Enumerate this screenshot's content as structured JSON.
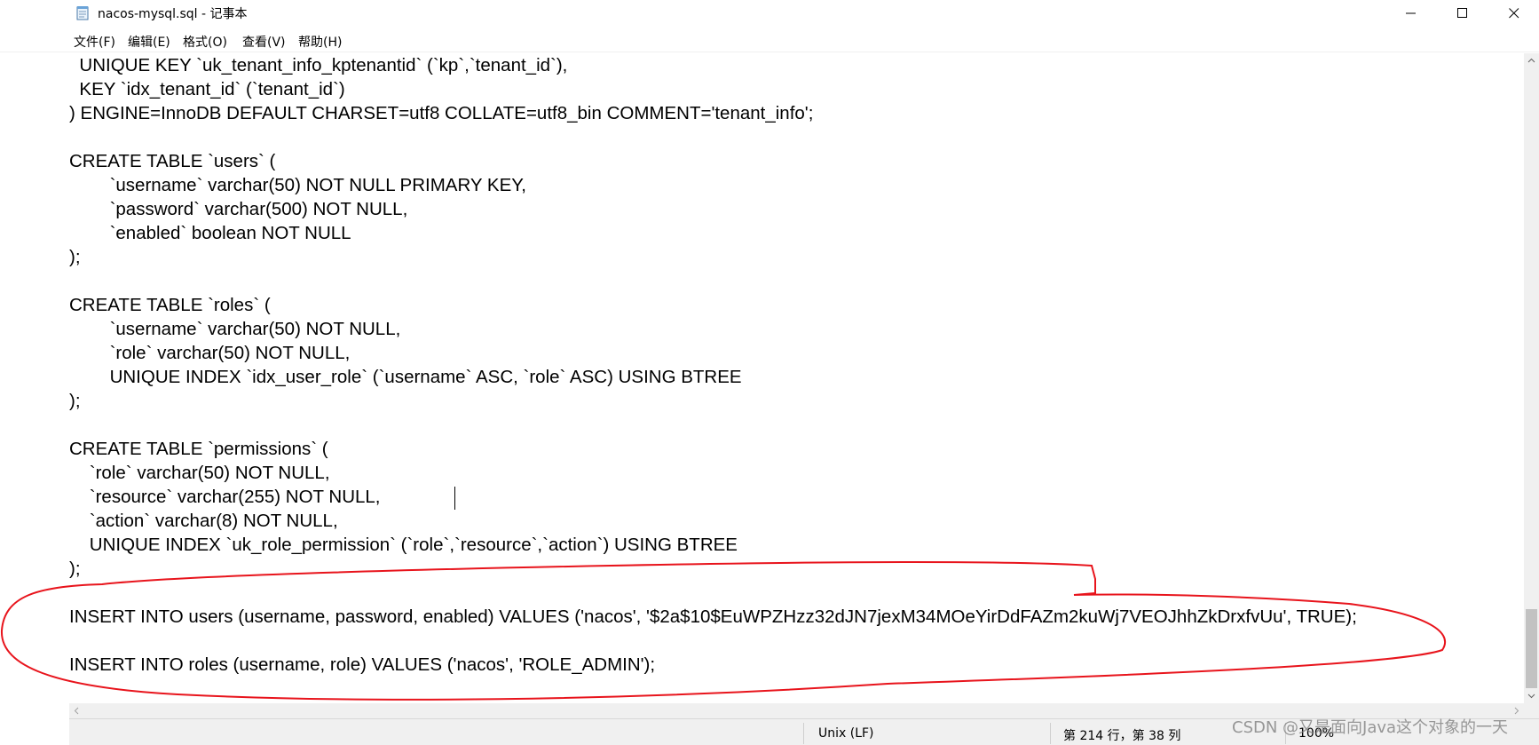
{
  "window": {
    "title": "nacos-mysql.sql - 记事本",
    "controls": {
      "minimize_icon": "minimize-icon",
      "maximize_icon": "maximize-icon",
      "close_icon": "close-icon"
    }
  },
  "menu": {
    "file": "文件(F)",
    "edit": "编辑(E)",
    "format": "格式(O)",
    "view": "查看(V)",
    "help": "帮助(H)"
  },
  "editor": {
    "lines": [
      "  UNIQUE KEY `uk_tenant_info_kptenantid` (`kp`,`tenant_id`),",
      "  KEY `idx_tenant_id` (`tenant_id`)",
      ") ENGINE=InnoDB DEFAULT CHARSET=utf8 COLLATE=utf8_bin COMMENT='tenant_info';",
      "",
      "CREATE TABLE `users` (",
      "\t`username` varchar(50) NOT NULL PRIMARY KEY,",
      "\t`password` varchar(500) NOT NULL,",
      "\t`enabled` boolean NOT NULL",
      ");",
      "",
      "CREATE TABLE `roles` (",
      "\t`username` varchar(50) NOT NULL,",
      "\t`role` varchar(50) NOT NULL,",
      "\tUNIQUE INDEX `idx_user_role` (`username` ASC, `role` ASC) USING BTREE",
      ");",
      "",
      "CREATE TABLE `permissions` (",
      "    `role` varchar(50) NOT NULL,",
      "    `resource` varchar(255) NOT NULL,",
      "    `action` varchar(8) NOT NULL,",
      "    UNIQUE INDEX `uk_role_permission` (`role`,`resource`,`action`) USING BTREE",
      ");",
      "",
      "INSERT INTO users (username, password, enabled) VALUES ('nacos', '$2a$10$EuWPZHzz32dJN7jexM34MOeYirDdFAZm2kuWj7VEOJhhZkDrxfvUu', TRUE);",
      "",
      "INSERT INTO roles (username, role) VALUES ('nacos', 'ROLE_ADMIN');"
    ]
  },
  "status": {
    "line_ending": "Unix (LF)",
    "position": "第 214 行，第 38 列",
    "zoom": "100%"
  },
  "watermark": "CSDN @又是面向Java这个对象的一天",
  "colors": {
    "annotation": "#e8141c",
    "status_bg": "#f0f0f0",
    "scroll_thumb": "#c2c2c2"
  }
}
